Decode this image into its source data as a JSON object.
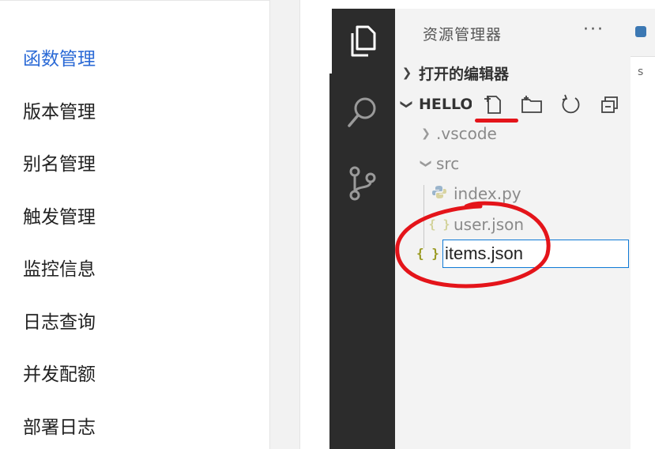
{
  "left_menu": {
    "items": [
      {
        "label": "函数管理",
        "active": true
      },
      {
        "label": "版本管理",
        "active": false
      },
      {
        "label": "别名管理",
        "active": false
      },
      {
        "label": "触发管理",
        "active": false
      },
      {
        "label": "监控信息",
        "active": false
      },
      {
        "label": "日志查询",
        "active": false
      },
      {
        "label": "并发配额",
        "active": false
      },
      {
        "label": "部署日志",
        "active": false
      }
    ],
    "active_color": "#2b6ad6"
  },
  "vscode": {
    "activity_bar": {
      "icons": [
        "explorer-icon",
        "search-icon",
        "source-control-icon"
      ]
    },
    "explorer": {
      "title": "资源管理器",
      "more_label": "···",
      "open_editors_label": "打开的编辑器",
      "workspace_label": "HELLO",
      "toolbar_icons": [
        "new-file-icon",
        "new-folder-icon",
        "refresh-icon",
        "collapse-all-icon"
      ],
      "tree": [
        {
          "label": ".vscode",
          "type": "folder",
          "expanded": false
        },
        {
          "label": "src",
          "type": "folder",
          "expanded": true
        },
        {
          "label": "index.py",
          "type": "python-file"
        },
        {
          "label": "user.json",
          "type": "json-file"
        }
      ],
      "new_file": {
        "icon_label": "{ }",
        "value": "items.json"
      }
    },
    "editor": {
      "snippet": "s"
    },
    "annotation_color": "#e4141a"
  }
}
